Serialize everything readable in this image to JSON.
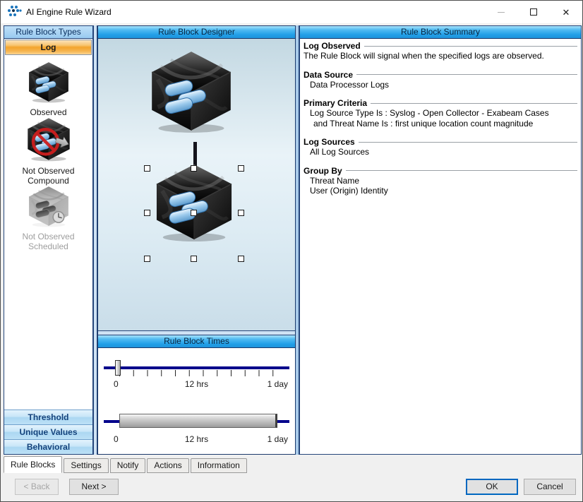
{
  "window": {
    "title": "AI Engine Rule Wizard",
    "controls": {
      "minimize": "minimize",
      "maximize": "maximize",
      "close": "✕"
    }
  },
  "icons": {
    "app_logo": "logrhythm-dots-logo",
    "observed": "open-cube-with-log-pills",
    "not_observed_compound": "open-cube-prohibition-sign-arrow",
    "not_observed_scheduled": "open-cube-clock-disabled"
  },
  "left_panel": {
    "header": "Rule Block Types",
    "active_tab": "Log",
    "items": [
      {
        "label": "Observed",
        "enabled": true
      },
      {
        "label": "Not Observed Compound",
        "enabled": true
      },
      {
        "label": "Not Observed Scheduled",
        "enabled": false
      }
    ],
    "bottom_buttons": [
      {
        "label": "Threshold"
      },
      {
        "label": "Unique Values"
      },
      {
        "label": "Behavioral"
      }
    ]
  },
  "designer": {
    "header": "Rule Block Designer"
  },
  "times": {
    "header": "Rule Block Times",
    "sliders": [
      {
        "labels": [
          "0",
          "12 hrs",
          "1 day"
        ]
      },
      {
        "labels": [
          "0",
          "12 hrs",
          "1 day"
        ]
      }
    ]
  },
  "summary": {
    "header": "Rule Block Summary",
    "sections": [
      {
        "title": "Log Observed",
        "lines": [
          "The Rule Block will signal when the specified logs are observed."
        ]
      },
      {
        "title": "Data Source",
        "lines": [
          "Data Processor Logs"
        ]
      },
      {
        "title": "Primary Criteria",
        "lines": [
          "Log Source Type Is : Syslog - Open Collector - Exabeam Cases",
          "and Threat Name Is : first unique location count magnitude"
        ]
      },
      {
        "title": "Log Sources",
        "lines": [
          "All Log Sources"
        ]
      },
      {
        "title": "Group By",
        "lines": [
          "Threat Name",
          "User (Origin) Identity"
        ]
      }
    ]
  },
  "tabs": [
    {
      "label": "Rule Blocks",
      "active": true
    },
    {
      "label": "Settings",
      "active": false
    },
    {
      "label": "Notify",
      "active": false
    },
    {
      "label": "Actions",
      "active": false
    },
    {
      "label": "Information",
      "active": false
    }
  ],
  "footer": {
    "back": "< Back",
    "next": "Next >",
    "ok": "OK",
    "cancel": "Cancel"
  },
  "colors": {
    "header_gradient_top": "#A8E3FB",
    "header_gradient_bottom": "#1E93DA",
    "log_tab_orange": "#F3A42C",
    "nav_button_blue": "#C8E6F8",
    "nav_button_text": "#15437C",
    "slider_track_navy": "#00008B",
    "prohibition_red": "#CE1E1E",
    "ok_focus_blue": "#0067C0",
    "pill_blue": "#8FC1E8"
  }
}
